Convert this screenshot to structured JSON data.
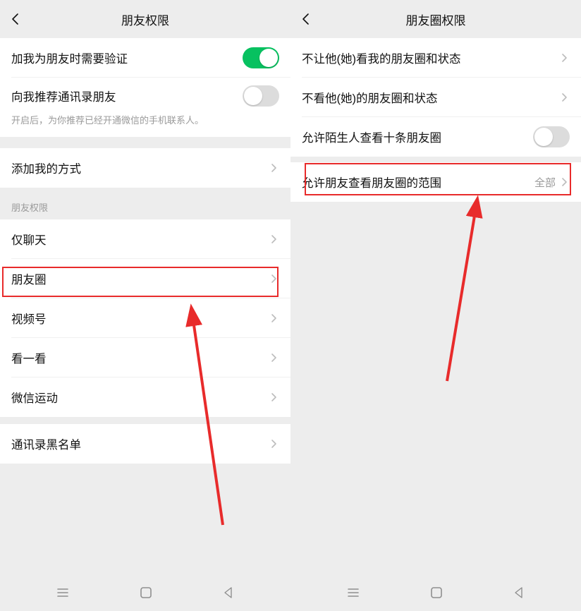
{
  "left": {
    "header_title": "朋友权限",
    "verify_friend_label": "加我为朋友时需要验证",
    "recommend_contacts_label": "向我推荐通讯录朋友",
    "recommend_desc": "开启后，为你推荐已经开通微信的手机联系人。",
    "add_method_label": "添加我的方式",
    "group_title": "朋友权限",
    "chat_only_label": "仅聊天",
    "moments_label": "朋友圈",
    "channels_label": "视频号",
    "kanyikan_label": "看一看",
    "werun_label": "微信运动",
    "blacklist_label": "通讯录黑名单"
  },
  "right": {
    "header_title": "朋友圈权限",
    "hide_my_label": "不让他(她)看我的朋友圈和状态",
    "hide_their_label": "不看他(她)的朋友圈和状态",
    "strangers_label": "允许陌生人查看十条朋友圈",
    "range_label": "允许朋友查看朋友圈的范围",
    "range_value": "全部"
  }
}
